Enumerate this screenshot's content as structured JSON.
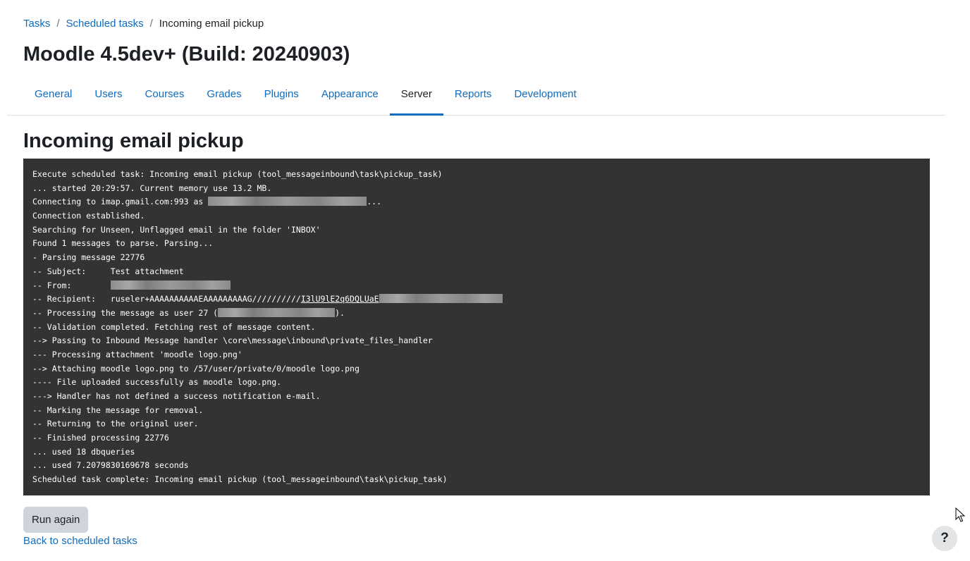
{
  "breadcrumb": {
    "items": [
      "Tasks",
      "Scheduled tasks"
    ],
    "separator": "/",
    "current": "Incoming email pickup"
  },
  "site_title": "Moodle 4.5dev+ (Build: 20240903)",
  "tabs": [
    {
      "label": "General"
    },
    {
      "label": "Users"
    },
    {
      "label": "Courses"
    },
    {
      "label": "Grades"
    },
    {
      "label": "Plugins"
    },
    {
      "label": "Appearance"
    },
    {
      "label": "Server"
    },
    {
      "label": "Reports"
    },
    {
      "label": "Development"
    }
  ],
  "active_tab": "Server",
  "page_heading": "Incoming email pickup",
  "console": {
    "l1": "Execute scheduled task: Incoming email pickup (tool_messageinbound\\task\\pickup_task)",
    "l2": "... started 20:29:57. Current memory use 13.2 MB.",
    "l3_pre": "Connecting to imap.gmail.com:993 as ",
    "l3_post": "...",
    "l4": "Connection established.",
    "l5": "Searching for Unseen, Unflagged email in the folder 'INBOX'",
    "l6": "Found 1 messages to parse. Parsing...",
    "l7": "- Parsing message 22776",
    "l8": "-- Subject:     Test attachment",
    "l9_pre": "-- From:        ",
    "l10_pre": "-- Recipient:   ruseler+AAAAAAAAAAEAAAAAAAAAG//////////",
    "l10_link": "I3lU9lE2q6DQLUaE",
    "l11_pre": "-- Processing the message as user 27 (",
    "l11_post": ").",
    "l12": "-- Validation completed. Fetching rest of message content.",
    "l13": "--> Passing to Inbound Message handler \\core\\message\\inbound\\private_files_handler",
    "l14": "--- Processing attachment 'moodle logo.png'",
    "l15": "--> Attaching moodle logo.png to /57/user/private/0/moodle logo.png",
    "l16": "---- File uploaded successfully as moodle logo.png.",
    "l17": "---> Handler has not defined a success notification e-mail.",
    "l18": "-- Marking the message for removal.",
    "l19": "-- Returning to the original user.",
    "l20": "-- Finished processing 22776",
    "l21": "... used 18 dbqueries",
    "l22": "... used 7.2079830169678 seconds",
    "l23": "Scheduled task complete: Incoming email pickup (tool_messageinbound\\task\\pickup_task)"
  },
  "run_again_label": "Run again",
  "back_link_label": "Back to scheduled tasks",
  "help_label": "?",
  "colors": {
    "link": "#0f6cbf",
    "console_bg": "#333333",
    "button_bg": "#ced4da",
    "active_tab_underline": "#0f6cbf"
  },
  "icons": [
    "question-icon",
    "mouse-cursor-icon"
  ]
}
